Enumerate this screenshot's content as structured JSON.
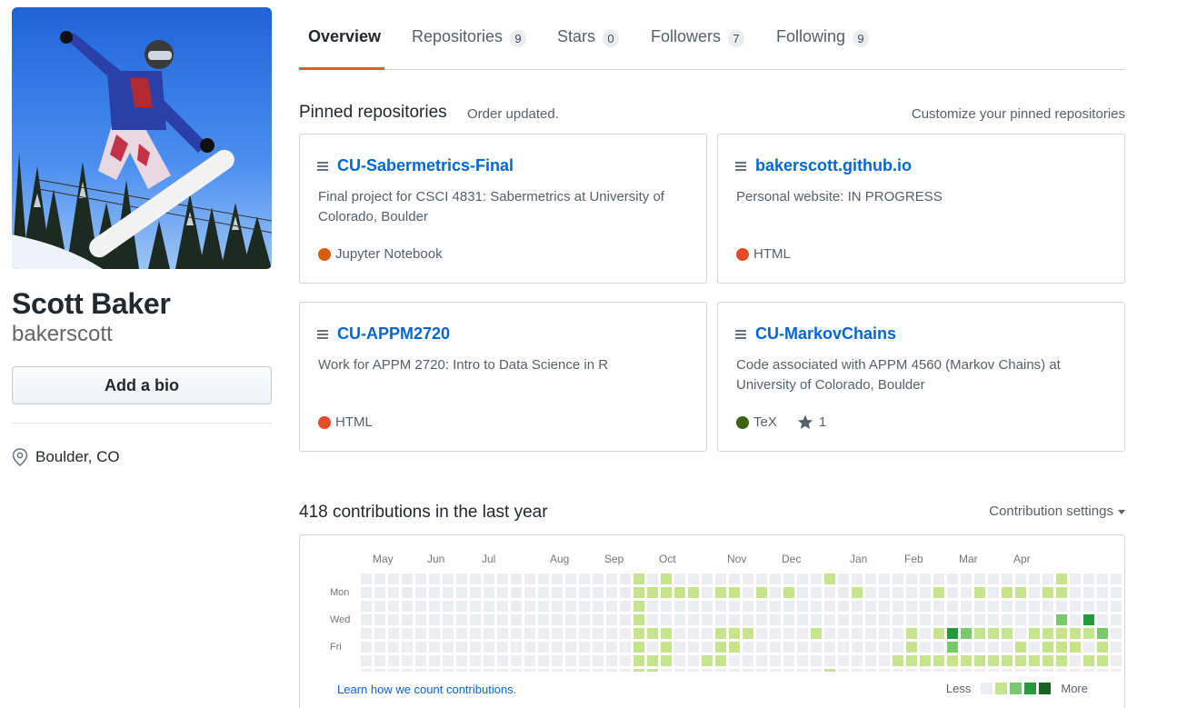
{
  "profile": {
    "name": "Scott Baker",
    "login": "bakerscott",
    "bio_button": "Add a bio",
    "location": "Boulder, CO"
  },
  "tabs": [
    {
      "label": "Overview",
      "count": null,
      "selected": true
    },
    {
      "label": "Repositories",
      "count": "9",
      "selected": false
    },
    {
      "label": "Stars",
      "count": "0",
      "selected": false
    },
    {
      "label": "Followers",
      "count": "7",
      "selected": false
    },
    {
      "label": "Following",
      "count": "9",
      "selected": false
    }
  ],
  "pinned": {
    "title": "Pinned repositories",
    "note": "Order updated.",
    "customize": "Customize your pinned repositories",
    "repos": [
      {
        "name": "CU-Sabermetrics-Final",
        "description": "Final project for CSCI 4831: Sabermetrics at University of Colorado, Boulder",
        "language": "Jupyter Notebook",
        "lang_color": "#DA5B0B",
        "stars": null
      },
      {
        "name": "bakerscott.github.io",
        "description": "Personal website: IN PROGRESS",
        "language": "HTML",
        "lang_color": "#e34c26",
        "stars": null
      },
      {
        "name": "CU-APPM2720",
        "description": "Work for APPM 2720: Intro to Data Science in R",
        "language": "HTML",
        "lang_color": "#e34c26",
        "stars": null
      },
      {
        "name": "CU-MarkovChains",
        "description": "Code associated with APPM 4560 (Markov Chains) at University of Colorado, Boulder",
        "language": "TeX",
        "lang_color": "#3D6117",
        "stars": "1"
      }
    ]
  },
  "contributions": {
    "title": "418 contributions in the last year",
    "settings": "Contribution settings",
    "months": [
      "May",
      "Jun",
      "Jul",
      "Aug",
      "Sep",
      "Oct",
      "Nov",
      "Dec",
      "Jan",
      "Feb",
      "Mar",
      "Apr"
    ],
    "days": [
      "Mon",
      "Wed",
      "Fri"
    ],
    "learn_link": "Learn how we count contributions.",
    "legend_less": "Less",
    "legend_more": "More",
    "colors": [
      "#ebedf0",
      "#c6e48b",
      "#7bc96f",
      "#239a3b",
      "#196127"
    ],
    "levels": [
      "0000000000000000000010100000000000100000000000000001000000000041",
      "0000000000000000000011111011010100001000001001011011000000000012",
      "0000000000000000000010000000000000000000000000000000000000000001",
      "0000000000000000000010000000000000000000000000000002030000000010",
      "0000000000000000000011100011100001000000101321110111112000001100",
      "0000000000000000000010100011000000000000100200001011101001111113",
      "0000000000000000000011100110000000000001111111111111011001121210",
      "0000000000000000000011000000000000100000000000000000000000000413"
    ]
  }
}
